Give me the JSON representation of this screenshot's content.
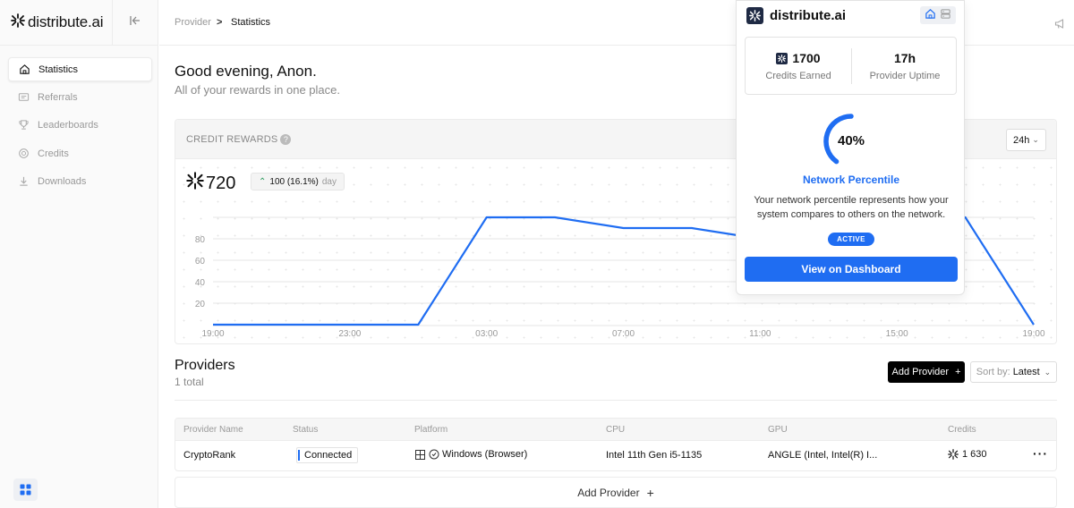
{
  "app": {
    "name": "distribute.ai",
    "accent_color": "#1f6df2"
  },
  "sidebar": {
    "items": [
      {
        "label": "Statistics",
        "icon": "home-icon",
        "active": true
      },
      {
        "label": "Referrals",
        "icon": "ticket-icon",
        "active": false
      },
      {
        "label": "Leaderboards",
        "icon": "trophy-icon",
        "active": false
      },
      {
        "label": "Credits",
        "icon": "coin-icon",
        "active": false
      },
      {
        "label": "Downloads",
        "icon": "download-icon",
        "active": false
      }
    ]
  },
  "breadcrumb": {
    "parent": "Provider",
    "separator": ">",
    "current": "Statistics"
  },
  "greeting": {
    "title": "Good evening, Anon.",
    "subtitle": "All of your rewards in one place."
  },
  "credit_rewards": {
    "title": "CREDIT REWARDS",
    "help": "?",
    "range": "24h",
    "total": "720",
    "delta": "100 (16.1%)",
    "delta_period": "day"
  },
  "chart_data": {
    "type": "line",
    "x": [
      "19:00",
      "23:00",
      "03:00",
      "07:00",
      "11:00",
      "15:00",
      "19:00"
    ],
    "x_ticks": [
      "19:00",
      "23:00",
      "03:00",
      "07:00",
      "11:00",
      "15:00",
      "19:00"
    ],
    "y_ticks": [
      20,
      40,
      60,
      80
    ],
    "ylim": [
      0,
      100
    ],
    "points": [
      [
        0,
        0
      ],
      [
        6,
        0
      ],
      [
        8,
        100
      ],
      [
        10,
        100
      ],
      [
        12,
        90
      ],
      [
        14,
        90
      ],
      [
        16,
        80
      ],
      [
        22,
        100
      ],
      [
        24,
        0
      ]
    ],
    "point_units": "x in hours after first 19:00 tick, y in credits",
    "line_color": "#1f6df2",
    "grid": true
  },
  "providers": {
    "title": "Providers",
    "count": "1 total",
    "add_label": "Add Provider",
    "add_symbol": "+",
    "sort_prefix": "Sort by:",
    "sort_value": "Latest",
    "columns": [
      "Provider Name",
      "Status",
      "Platform",
      "CPU",
      "GPU",
      "Credits"
    ],
    "rows": [
      {
        "name": "CryptoRank",
        "status": "Connected",
        "platform": "Windows (Browser)",
        "cpu": "Intel 11th Gen i5-1135",
        "gpu": "ANGLE (Intel, Intel(R) I...",
        "credits": "1 630",
        "more": "···"
      }
    ],
    "add_row_label": "Add Provider",
    "add_row_symbol": "+"
  },
  "popup": {
    "name": "distribute.ai",
    "credits_value": "1700",
    "credits_label": "Credits Earned",
    "uptime_value": "17h",
    "uptime_label": "Provider Uptime",
    "percentile_value": "40%",
    "percentile_fraction": 0.4,
    "percentile_title": "Network Percentile",
    "percentile_desc": "Your network percentile represents how your system compares to others on the network.",
    "status_badge": "ACTIVE",
    "dashboard_button": "View on Dashboard"
  }
}
